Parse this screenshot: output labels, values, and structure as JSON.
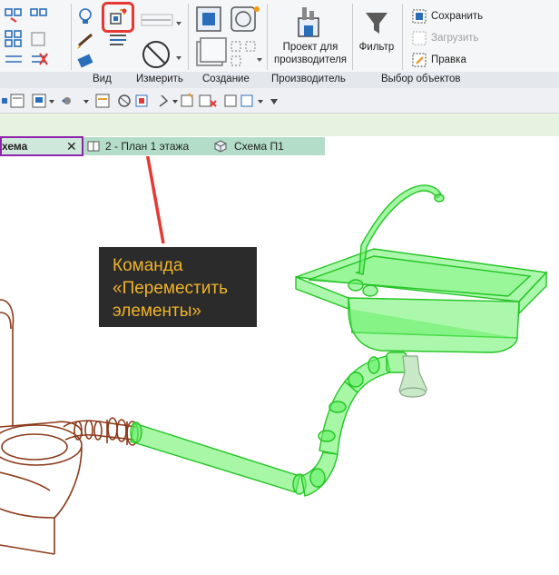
{
  "ribbon": {
    "panels": {
      "view": "Вид",
      "measure": "Измерить",
      "create": "Создание",
      "manufacturer": "Производитель",
      "selection": "Выбор объектов"
    },
    "measure_label": "Измерить",
    "manufacturer_button": [
      "Проект для",
      "производителя"
    ],
    "filter_button": "Фильтр",
    "selection_buttons": {
      "save": "Сохранить",
      "load": "Загрузить",
      "edit": "Правка"
    }
  },
  "tabs": [
    {
      "label": "хема",
      "active": true,
      "icon": "close-icon"
    },
    {
      "label": "2 - План 1 этажа",
      "active": false,
      "icon": "floor-plan-icon"
    },
    {
      "label": "Схема П1",
      "active": false,
      "icon": "3d-view-icon"
    }
  ],
  "callout": {
    "lines": [
      "Команда",
      "«Переместить",
      "элементы»"
    ]
  },
  "colors": {
    "callout_bg": "#2b2b2b",
    "callout_text": "#f0b429",
    "highlight_red": "#e53935",
    "selected_green": "#33dd33",
    "fixture_brown": "#8b3a1a",
    "active_tab_border": "#8e24aa"
  }
}
